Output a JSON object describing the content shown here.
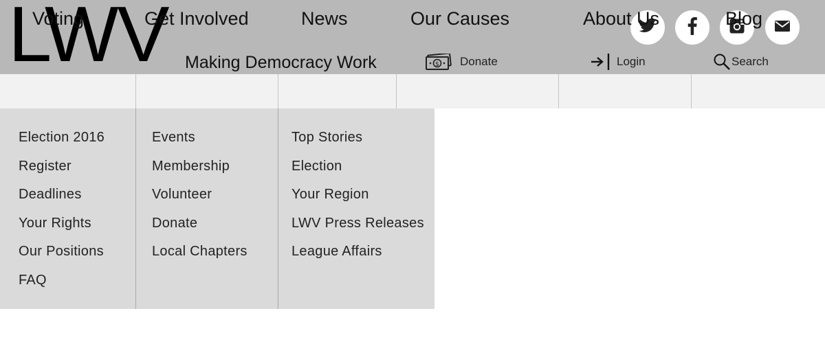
{
  "brand": {
    "logo": "LWV",
    "tagline": "Making Democracy Work"
  },
  "utility": {
    "donate_label": "Donate",
    "login_label": "Login",
    "search_label": "Search"
  },
  "social": [
    "twitter-icon",
    "facebook-icon",
    "instagram-icon",
    "email-icon"
  ],
  "nav": [
    {
      "label": "Voting"
    },
    {
      "label": "Get Involved"
    },
    {
      "label": "News"
    },
    {
      "label": "Our Causes"
    },
    {
      "label": "About Us"
    },
    {
      "label": "Blog"
    }
  ],
  "dropdown": {
    "voting": [
      "Election 2016",
      "Register",
      "Deadlines",
      "Your Rights",
      "Our Positions",
      "FAQ"
    ],
    "get_involved": [
      "Events",
      "Membership",
      "Volunteer",
      "Donate",
      "Local Chapters"
    ],
    "news": [
      "Top Stories",
      "Election",
      "Your Region",
      "LWV Press Releases",
      "League Affairs"
    ]
  },
  "colors": {
    "header_bg": "#b8b8b8",
    "nav_bg": "#f2f2f2",
    "dropdown_bg": "#dadada"
  }
}
